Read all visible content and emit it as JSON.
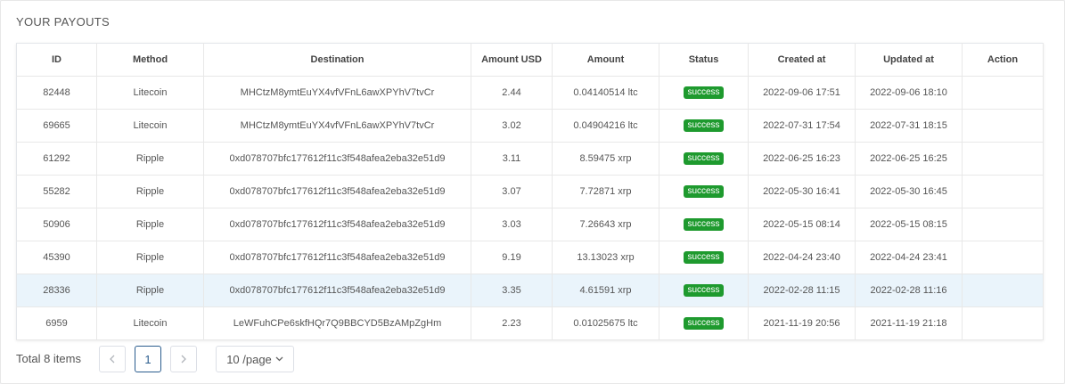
{
  "title": "YOUR PAYOUTS",
  "columns": [
    "ID",
    "Method",
    "Destination",
    "Amount USD",
    "Amount",
    "Status",
    "Created at",
    "Updated at",
    "Action"
  ],
  "rows": [
    {
      "id": "82448",
      "method": "Litecoin",
      "destination": "MHCtzM8ymtEuYX4vfVFnL6awXPYhV7tvCr",
      "amount_usd": "2.44",
      "amount": "0.04140514 ltc",
      "status": "success",
      "created": "2022-09-06 17:51",
      "updated": "2022-09-06 18:10",
      "action": ""
    },
    {
      "id": "69665",
      "method": "Litecoin",
      "destination": "MHCtzM8ymtEuYX4vfVFnL6awXPYhV7tvCr",
      "amount_usd": "3.02",
      "amount": "0.04904216 ltc",
      "status": "success",
      "created": "2022-07-31 17:54",
      "updated": "2022-07-31 18:15",
      "action": ""
    },
    {
      "id": "61292",
      "method": "Ripple",
      "destination": "0xd078707bfc177612f11c3f548afea2eba32e51d9",
      "amount_usd": "3.11",
      "amount": "8.59475 xrp",
      "status": "success",
      "created": "2022-06-25 16:23",
      "updated": "2022-06-25 16:25",
      "action": ""
    },
    {
      "id": "55282",
      "method": "Ripple",
      "destination": "0xd078707bfc177612f11c3f548afea2eba32e51d9",
      "amount_usd": "3.07",
      "amount": "7.72871 xrp",
      "status": "success",
      "created": "2022-05-30 16:41",
      "updated": "2022-05-30 16:45",
      "action": ""
    },
    {
      "id": "50906",
      "method": "Ripple",
      "destination": "0xd078707bfc177612f11c3f548afea2eba32e51d9",
      "amount_usd": "3.03",
      "amount": "7.26643 xrp",
      "status": "success",
      "created": "2022-05-15 08:14",
      "updated": "2022-05-15 08:15",
      "action": ""
    },
    {
      "id": "45390",
      "method": "Ripple",
      "destination": "0xd078707bfc177612f11c3f548afea2eba32e51d9",
      "amount_usd": "9.19",
      "amount": "13.13023 xrp",
      "status": "success",
      "created": "2022-04-24 23:40",
      "updated": "2022-04-24 23:41",
      "action": ""
    },
    {
      "id": "28336",
      "method": "Ripple",
      "destination": "0xd078707bfc177612f11c3f548afea2eba32e51d9",
      "amount_usd": "3.35",
      "amount": "4.61591 xrp",
      "status": "success",
      "created": "2022-02-28 11:15",
      "updated": "2022-02-28 11:16",
      "action": ""
    },
    {
      "id": "6959",
      "method": "Litecoin",
      "destination": "LeWFuhCPe6skfHQr7Q9BBCYD5BzAMpZgHm",
      "amount_usd": "2.23",
      "amount": "0.01025675 ltc",
      "status": "success",
      "created": "2021-11-19 20:56",
      "updated": "2021-11-19 21:18",
      "action": ""
    }
  ],
  "highlighted_row": 6,
  "pagination": {
    "total_label": "Total 8 items",
    "current_page": "1",
    "page_size_label": "10 /page",
    "prev_icon": "chevron-left-icon",
    "next_icon": "chevron-right-icon"
  },
  "colors": {
    "success_badge": "#1e9a2e",
    "active_page_border": "#2b5d8e",
    "row_highlight": "#eaf4fb"
  }
}
